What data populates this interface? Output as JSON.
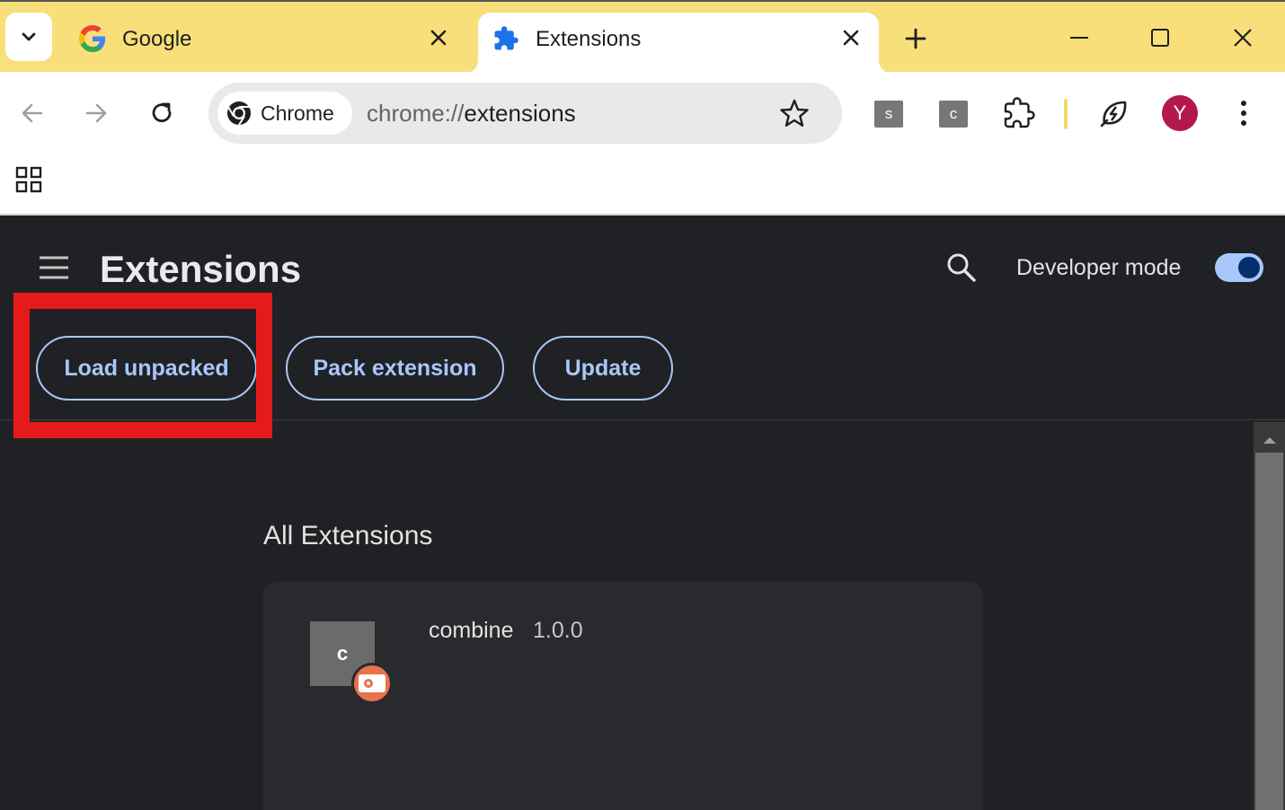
{
  "tabs": [
    {
      "title": "Google",
      "favicon": "google-g-icon"
    },
    {
      "title": "Extensions",
      "favicon": "puzzle-icon"
    }
  ],
  "toolbar": {
    "chip_label": "Chrome",
    "url_prefix": "chrome://",
    "url_host": "extensions",
    "extension_badges": [
      "s",
      "c"
    ],
    "avatar_letter": "Y"
  },
  "page": {
    "title": "Extensions",
    "developer_mode_label": "Developer mode",
    "developer_mode_on": true,
    "buttons": {
      "load_unpacked": "Load unpacked",
      "pack_extension": "Pack extension",
      "update": "Update"
    },
    "section_title": "All Extensions",
    "extensions": [
      {
        "icon_letter": "c",
        "name": "combine",
        "version": "1.0.0"
      }
    ]
  },
  "colors": {
    "tabstrip": "#f8df7a",
    "accent": "#a8c7fa",
    "highlight_box": "#e51b1b",
    "avatar": "#b3174e"
  }
}
